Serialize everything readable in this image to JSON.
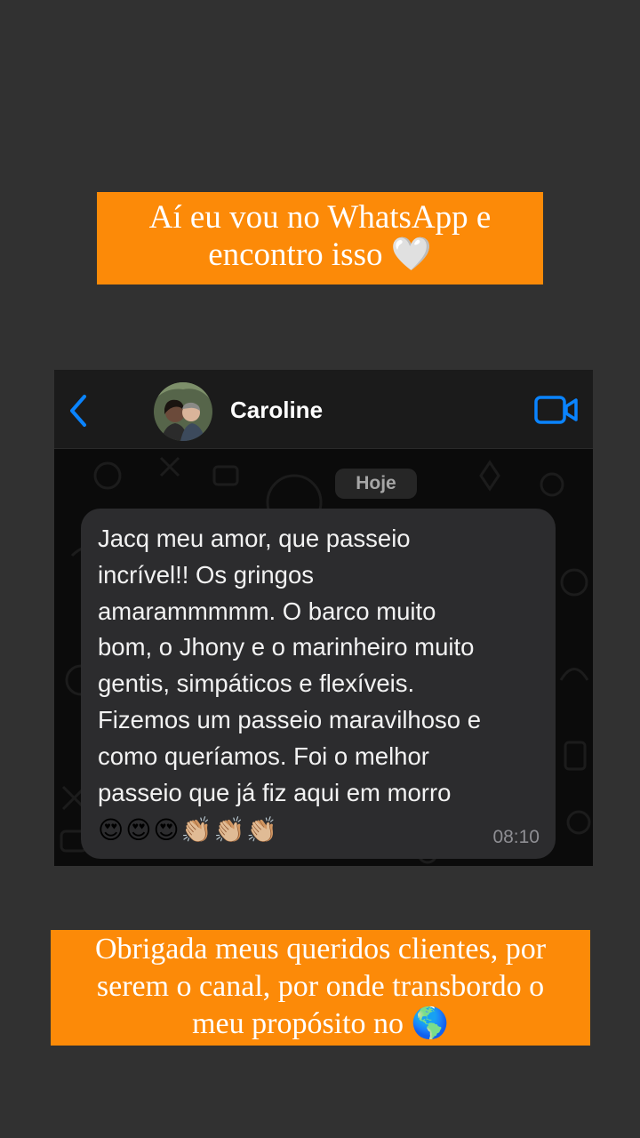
{
  "captions": {
    "top": [
      "Aí eu vou no WhatsApp e",
      "encontro isso 🤍"
    ],
    "bottom": [
      "Obrigada meus queridos clientes, por",
      "serem o canal, por onde transbordo o",
      "meu propósito no 🌎"
    ]
  },
  "chat": {
    "contact_name": "Caroline",
    "icons": {
      "back": "chevron-left-icon",
      "video": "video-camera-icon"
    },
    "accent_color": "#0a84ff",
    "date_label": "Hoje",
    "message": {
      "text": "Jacq meu amor, que passeio\nincrível!! Os gringos\namarammmmm. O barco muito\nbom, o Jhony e o marinheiro muito\ngentis, simpáticos e flexíveis.\nFizemos um passeio maravilhoso e\ncomo queríamos. Foi o melhor\npasseio que já fiz aqui em morro",
      "emojis": [
        "😍",
        "😍",
        "😍",
        "👏🏼",
        "👏🏼",
        "👏🏼"
      ],
      "time": "08:10"
    }
  }
}
